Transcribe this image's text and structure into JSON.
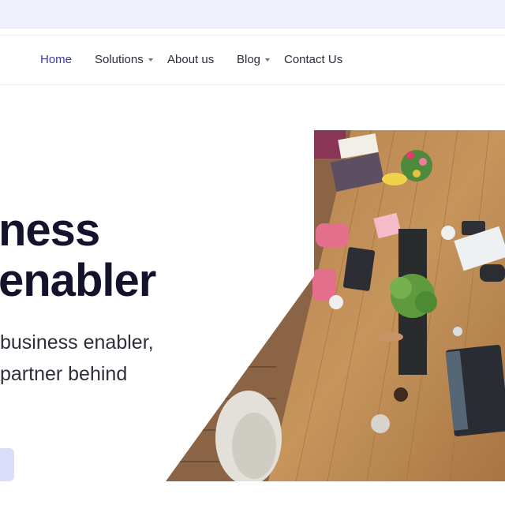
{
  "nav": {
    "items": [
      {
        "label": "Home",
        "active": true
      },
      {
        "label": "Solutions",
        "dropdown": true
      },
      {
        "label": "About us"
      },
      {
        "label": "Blog",
        "dropdown": true
      },
      {
        "label": "Contact Us"
      }
    ]
  },
  "hero": {
    "title_line1": "ness",
    "title_line2": "enabler",
    "subtitle_line1": "business enabler,",
    "subtitle_line2": "partner behind"
  },
  "colors": {
    "accent": "#3a36b0",
    "cta_bg": "#dcdcfb",
    "title": "#13142b"
  }
}
